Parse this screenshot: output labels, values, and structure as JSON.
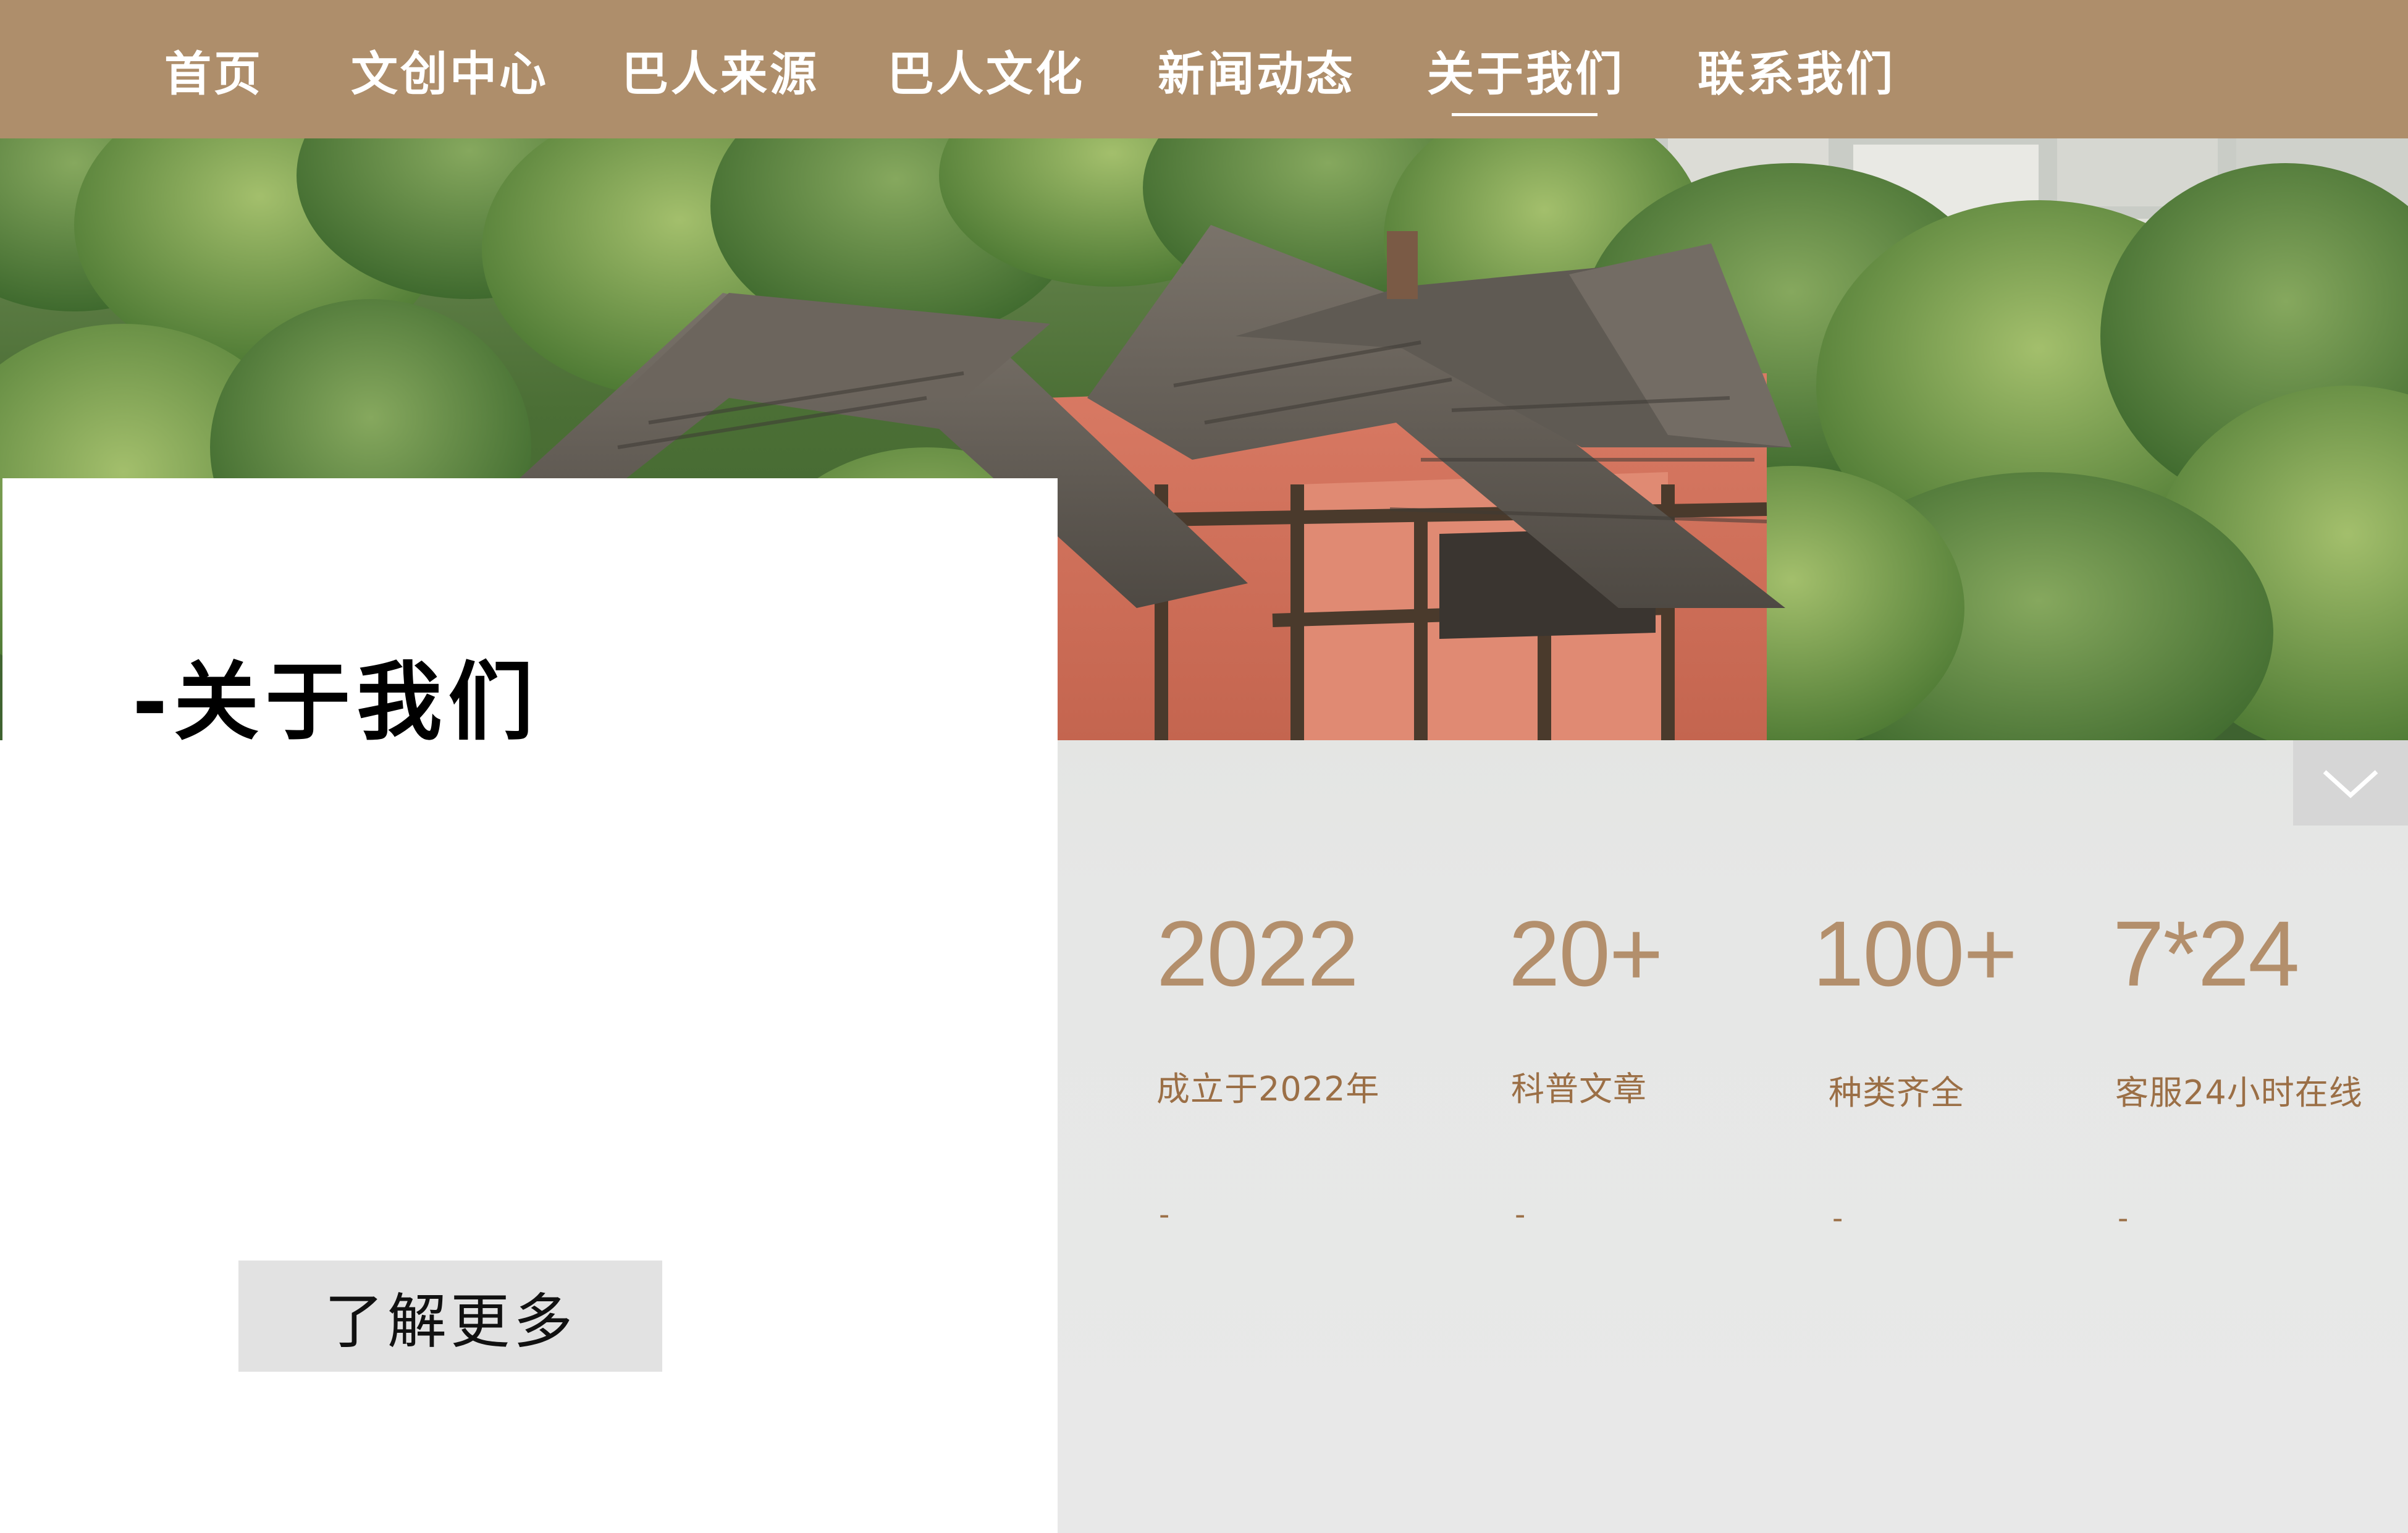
{
  "nav": {
    "items": [
      {
        "label": "首页"
      },
      {
        "label": "文创中心"
      },
      {
        "label": "巴人来源"
      },
      {
        "label": "巴人文化"
      },
      {
        "label": "新闻动态"
      },
      {
        "label": "关于我们",
        "active": true
      },
      {
        "label": "联系我们"
      }
    ]
  },
  "about": {
    "title": "-关于我们",
    "more_button": "了解更多"
  },
  "stats": [
    {
      "number": "2022",
      "label": "成立于2022年",
      "dash": "-"
    },
    {
      "number": "20+",
      "label": "科普文章",
      "dash": "-"
    },
    {
      "number": "100+",
      "label": "种类齐全",
      "dash": "-"
    },
    {
      "number": "7*24",
      "label": "客服24小时在线",
      "dash": "-"
    }
  ],
  "colors": {
    "nav_bg": "#ae8e6b",
    "stat_number": "#b38f6c",
    "stat_label": "#9b6f46",
    "panel_bg": "#e8e8e8",
    "button_bg": "#e2e2e2"
  },
  "icons": {
    "collapse": "chevron-down-icon"
  }
}
